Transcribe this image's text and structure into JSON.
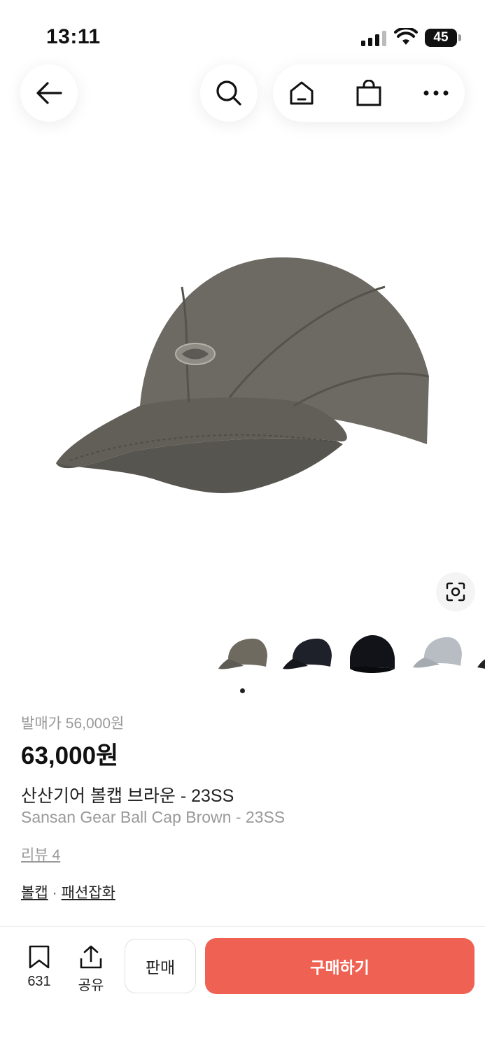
{
  "status_bar": {
    "time": "13:11",
    "battery": "45"
  },
  "nav": {
    "back_icon": "arrow-left-icon",
    "search_icon": "search-icon",
    "home_icon": "home-icon",
    "bag_icon": "shopping-bag-icon",
    "more_icon": "more-horizontal-icon"
  },
  "product": {
    "image_icon": "cap-image",
    "thumbnail_colors": [
      "#6e6a60",
      "#1e2129",
      "#111318",
      "#b8bdc4",
      "#222"
    ],
    "release_price": "발매가 56,000원",
    "price": "63,000원",
    "name_ko": "산산기어 볼캡 브라운 - 23SS",
    "name_en": "Sansan Gear Ball Cap Brown - 23SS",
    "reviews": "리뷰 4",
    "tags": [
      "볼캡",
      "패션잡화"
    ]
  },
  "bottom_bar": {
    "bookmark_count": "631",
    "share_label": "공유",
    "sell_label": "판매",
    "buy_label": "구매하기",
    "accent_color": "#ef6253"
  }
}
